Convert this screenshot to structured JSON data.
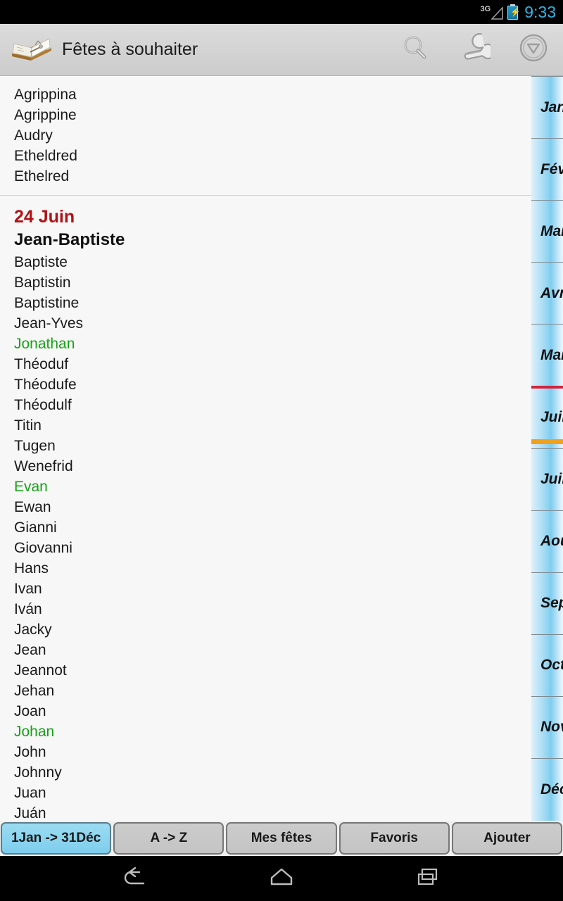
{
  "statusbar": {
    "network_label": "3G",
    "time": "9:33",
    "signal_icon": "signal-triangle-icon",
    "battery_icon": "battery-charging-icon",
    "time_color": "#34b4e4"
  },
  "actionbar": {
    "app_icon": "open-book-icon",
    "title": "Fêtes à souhaiter",
    "actions": [
      {
        "name": "search-icon",
        "label": "Rechercher"
      },
      {
        "name": "wrench-icon",
        "label": "Outils"
      },
      {
        "name": "circle-chevron-down-icon",
        "label": "Plus"
      }
    ]
  },
  "list": {
    "previous_group_names": [
      "Agrippina",
      "Agrippine",
      "Audry",
      "Etheldred",
      "Ethelred"
    ],
    "current_group": {
      "date": "24 Juin",
      "date_color": "#b01317",
      "saint": "Jean-Baptiste",
      "favorite_color": "#18a018",
      "names": [
        {
          "text": "Baptiste",
          "favorite": false
        },
        {
          "text": "Baptistin",
          "favorite": false
        },
        {
          "text": "Baptistine",
          "favorite": false
        },
        {
          "text": "Jean-Yves",
          "favorite": false
        },
        {
          "text": "Jonathan",
          "favorite": true
        },
        {
          "text": "Théoduf",
          "favorite": false
        },
        {
          "text": "Théodufe",
          "favorite": false
        },
        {
          "text": "Théodulf",
          "favorite": false
        },
        {
          "text": "Titin",
          "favorite": false
        },
        {
          "text": "Tugen",
          "favorite": false
        },
        {
          "text": "Wenefrid",
          "favorite": false
        },
        {
          "text": "Evan",
          "favorite": true
        },
        {
          "text": "Ewan",
          "favorite": false
        },
        {
          "text": "Gianni",
          "favorite": false
        },
        {
          "text": "Giovanni",
          "favorite": false
        },
        {
          "text": "Hans",
          "favorite": false
        },
        {
          "text": "Ivan",
          "favorite": false
        },
        {
          "text": "Iván",
          "favorite": false
        },
        {
          "text": "Jacky",
          "favorite": false
        },
        {
          "text": "Jean",
          "favorite": false
        },
        {
          "text": "Jeannot",
          "favorite": false
        },
        {
          "text": "Jehan",
          "favorite": false
        },
        {
          "text": "Joan",
          "favorite": false
        },
        {
          "text": "Johan",
          "favorite": true
        },
        {
          "text": "John",
          "favorite": false
        },
        {
          "text": "Johnny",
          "favorite": false
        },
        {
          "text": "Juan",
          "favorite": false
        },
        {
          "text": "Juán",
          "favorite": false
        }
      ]
    }
  },
  "months": {
    "selected": "Juin",
    "marker_top_color": "#d4233c",
    "marker_bottom_color": "#f2a11c",
    "items": [
      {
        "label": "Jan"
      },
      {
        "label": "Fév"
      },
      {
        "label": "Mar"
      },
      {
        "label": "Avri"
      },
      {
        "label": "Mai"
      },
      {
        "label": "Juin"
      },
      {
        "label": "Juil"
      },
      {
        "label": "Aoû"
      },
      {
        "label": "Sep"
      },
      {
        "label": "Octo"
      },
      {
        "label": "Nov"
      },
      {
        "label": "Déc"
      }
    ]
  },
  "tabs": [
    {
      "label": "1Jan -> 31Déc",
      "active": true
    },
    {
      "label": "A -> Z",
      "active": false
    },
    {
      "label": "Mes fêtes",
      "active": false
    },
    {
      "label": "Favoris",
      "active": false
    },
    {
      "label": "Ajouter",
      "active": false
    }
  ],
  "navbar": {
    "buttons": [
      {
        "name": "back-icon"
      },
      {
        "name": "home-icon"
      },
      {
        "name": "recents-icon"
      }
    ]
  }
}
